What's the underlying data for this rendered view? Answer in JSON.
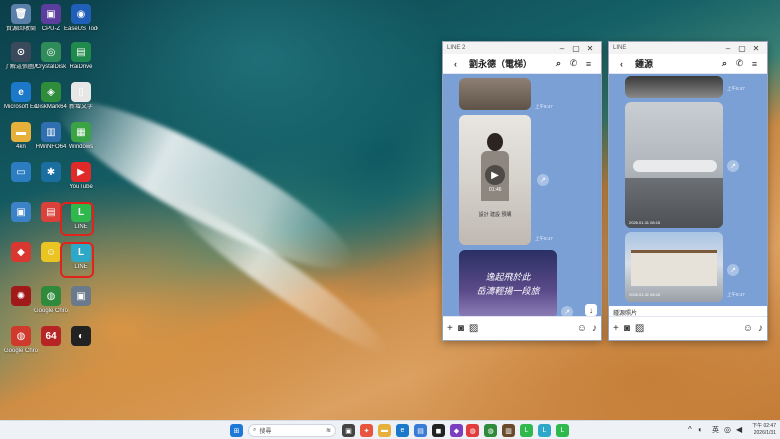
{
  "desktop": {
    "icons": [
      {
        "label": "資源回收筒",
        "glyph": "🗑",
        "color": "#5a7fa8"
      },
      {
        "label": "CPU-Z",
        "glyph": "▣",
        "color": "#5b3d9e"
      },
      {
        "label": "EaseUS Todo",
        "glyph": "◉",
        "color": "#1f5fb8"
      },
      {
        "label": "了解這張圖片",
        "glyph": "⊙",
        "color": "#3a4a5a"
      },
      {
        "label": "CrystalDisk",
        "glyph": "◎",
        "color": "#2f8b5a"
      },
      {
        "label": "RaiDrive",
        "glyph": "▤",
        "color": "#1f8a4b"
      },
      {
        "label": "Microsoft Edge",
        "glyph": "e",
        "color": "#1c78c8"
      },
      {
        "label": "DiskMark64",
        "glyph": "◈",
        "color": "#2e8c3a"
      },
      {
        "label": "新增文字",
        "glyph": "▯",
        "color": "#e7e7e7"
      },
      {
        "label": "4kn",
        "glyph": "▬",
        "color": "#e6b03a"
      },
      {
        "label": "HWiNFO64",
        "glyph": "▥",
        "color": "#2f6fb0"
      },
      {
        "label": "Windows",
        "glyph": "▦",
        "color": "#3aa344"
      },
      {
        "label": "",
        "glyph": "▭",
        "color": "#2b7cc0"
      },
      {
        "label": "",
        "glyph": "✱",
        "color": "#1b6ea0"
      },
      {
        "label": "YouTube",
        "glyph": "▶",
        "color": "#e02a2a"
      },
      {
        "label": "",
        "glyph": "▣",
        "color": "#3b82c6"
      },
      {
        "label": "",
        "glyph": "▤",
        "color": "#d9413a"
      },
      {
        "label": "LINE",
        "glyph": "L",
        "color": "#2fb84c"
      },
      {
        "label": "",
        "glyph": "◆",
        "color": "#d8382f"
      },
      {
        "label": "",
        "glyph": "☺",
        "color": "#e9c422"
      },
      {
        "label": "LINE",
        "glyph": "L",
        "color": "#2da8c8"
      },
      {
        "label": "",
        "glyph": "✺",
        "color": "#a01a1a"
      },
      {
        "label": "Google Chrome",
        "glyph": "◍",
        "color": "#2f8a3c"
      },
      {
        "label": "",
        "glyph": "▣",
        "color": "#6a7a8c"
      },
      {
        "label": "Google Chrome",
        "glyph": "◍",
        "color": "#d03a2c"
      },
      {
        "label": "",
        "glyph": "64",
        "color": "#b62424"
      },
      {
        "label": "",
        "glyph": "◐",
        "color": "#222222"
      }
    ]
  },
  "window1": {
    "title": "LINE 2",
    "chat_name": "劉永德（電梯）",
    "video_duration": "01:46",
    "caption_line1": "設計 建設 預購",
    "calligraphy_1": "逸起飛於此",
    "calligraphy_2": "岳濤輕揚一段旅",
    "ts1": "上午8:47",
    "ts2": "上午8:47",
    "ts3": "上午8:47"
  },
  "window2": {
    "title": "LINE",
    "chat_name": "鍾源",
    "photo_ts1": "2026.01.31 08:15",
    "photo_ts2": "2026.01.31 08:16",
    "ts1": "上午8:47",
    "ts2": "上午8:47",
    "ts3": "上午8:47",
    "bottom_caption": "鍾源照片"
  },
  "taskbar": {
    "search_placeholder": "搜尋",
    "lang": "英",
    "time": "下午 02:47",
    "date": "2026/1/31"
  }
}
